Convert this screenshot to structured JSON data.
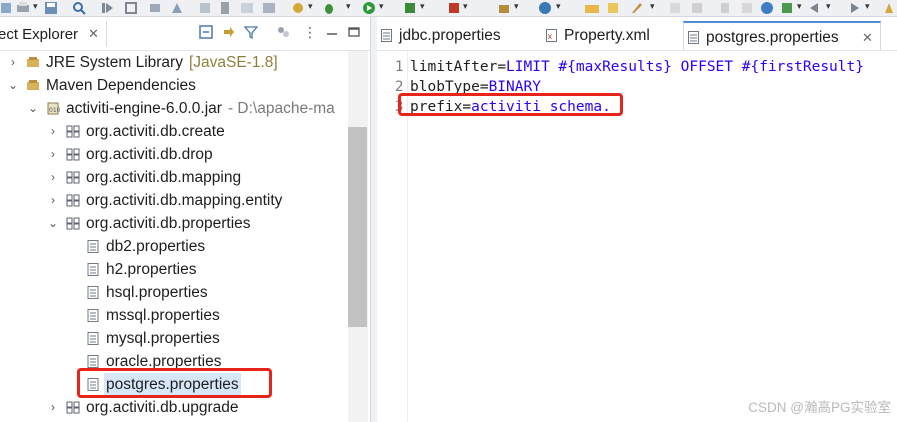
{
  "toolbar": {
    "icons": [
      "save-all-icon",
      "print-icon",
      "search-icon",
      "run-icon",
      "debug-icon",
      "skip-icon",
      "build-icon",
      "new-java-icon",
      "open-type-icon",
      "debug-bug-icon",
      "run-green-icon",
      "external-tools-icon",
      "new-package-icon",
      "spring-icon",
      "folder-open-icon",
      "edit-icon",
      "globe-icon",
      "back-icon",
      "forward-icon"
    ]
  },
  "explorer": {
    "tab_label": "ect Explorer",
    "close_glyph": "✕",
    "tools": [
      "collapse-all-icon",
      "link-editor-icon",
      "filter-icon",
      "view-menu-icon",
      "minimize-icon",
      "maximize-icon"
    ],
    "tree": [
      {
        "label": "JRE System Library",
        "suffix": "[JavaSE-1.8]",
        "expanded": false,
        "icon": "library-icon"
      },
      {
        "label": "Maven Dependencies",
        "expanded": true,
        "icon": "library-icon"
      },
      {
        "label": "activiti-engine-6.0.0.jar",
        "suffix": "- D:\\apache-ma",
        "expanded": true,
        "icon": "jar-icon"
      },
      {
        "label": "org.activiti.db.create",
        "expanded": false,
        "icon": "package-icon"
      },
      {
        "label": "org.activiti.db.drop",
        "expanded": false,
        "icon": "package-icon"
      },
      {
        "label": "org.activiti.db.mapping",
        "expanded": false,
        "icon": "package-icon"
      },
      {
        "label": "org.activiti.db.mapping.entity",
        "expanded": false,
        "icon": "package-icon"
      },
      {
        "label": "org.activiti.db.properties",
        "expanded": true,
        "icon": "package-icon"
      },
      {
        "label": "db2.properties",
        "icon": "file-icon"
      },
      {
        "label": "h2.properties",
        "icon": "file-icon"
      },
      {
        "label": "hsql.properties",
        "icon": "file-icon"
      },
      {
        "label": "mssql.properties",
        "icon": "file-icon"
      },
      {
        "label": "mysql.properties",
        "icon": "file-icon"
      },
      {
        "label": "oracle.properties",
        "icon": "file-icon"
      },
      {
        "label": "postgres.properties",
        "icon": "file-icon",
        "selected": true
      },
      {
        "label": "org.activiti.db.upgrade",
        "expanded": false,
        "icon": "package-icon"
      }
    ]
  },
  "editor": {
    "tabs": [
      {
        "label": "jdbc.properties",
        "active": false,
        "icon": "properties-file-icon"
      },
      {
        "label": "Property.xml",
        "active": false,
        "icon": "xml-file-icon"
      },
      {
        "label": "postgres.properties",
        "active": true,
        "icon": "properties-file-icon"
      }
    ],
    "close_glyph": "✕",
    "lines": [
      {
        "num": "1",
        "key": "limitAfter",
        "eq": "=",
        "value": "LIMIT #{maxResults} OFFSET #{firstResult}"
      },
      {
        "num": "2",
        "key": "blobType",
        "eq": "=",
        "value": "BINARY"
      },
      {
        "num": "3",
        "key": "prefix",
        "eq": "=",
        "value": "activiti_schema."
      }
    ]
  },
  "watermark": "CSDN @瀚高PG实验室",
  "colors": {
    "annotation": "#e8231a",
    "selection": "#d5e7f8",
    "keyword_value": "#2a00ff"
  }
}
